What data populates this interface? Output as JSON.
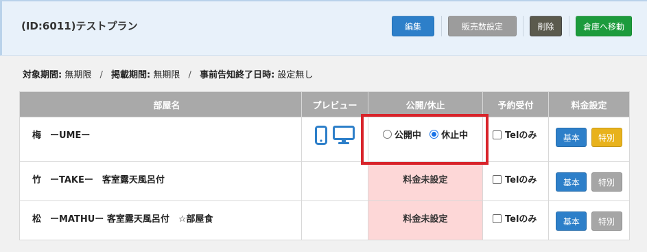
{
  "plan": {
    "title": "(ID:6011)テストプラン"
  },
  "toolbar": {
    "edit_label": "編集",
    "sales_count_label": "販売数設定",
    "delete_label": "削除",
    "move_label": "倉庫へ移動"
  },
  "period": {
    "target_label": "対象期間:",
    "target_value": "無期限",
    "listing_label": "掲載期間:",
    "listing_value": "無期限",
    "notice_label": "事前告知終了日時:",
    "notice_value": "設定無し",
    "separator": "/"
  },
  "table": {
    "headers": {
      "room": "部屋名",
      "preview": "プレビュー",
      "publish": "公開/休止",
      "reservation": "予約受付",
      "fee": "料金設定"
    },
    "rows": [
      {
        "room": "梅　ーUMEー",
        "publish_open_label": "公開中",
        "publish_pause_label": "休止中",
        "publish_selected": "休止中",
        "publish_status": "",
        "tel_label": "Telのみ",
        "tel_checked": false,
        "fee_basic": "基本",
        "fee_special": "特別",
        "fee_special_active": true,
        "preview_icons": [
          "smartphone-icon",
          "monitor-icon"
        ]
      },
      {
        "room": "竹　ーTAKEー　客室露天風呂付",
        "publish_status": "料金未設定",
        "tel_label": "Telのみ",
        "tel_checked": false,
        "fee_basic": "基本",
        "fee_special": "特別",
        "fee_special_active": false
      },
      {
        "room": "松　ーMATHUー 客室露天風呂付　☆部屋食",
        "publish_status": "料金未設定",
        "tel_label": "Telのみ",
        "tel_checked": false,
        "fee_basic": "基本",
        "fee_special": "特別",
        "fee_special_active": false
      }
    ]
  },
  "colors": {
    "header_bg": "#e8f1fa",
    "edit_button": "#2d7fc9",
    "sales_button": "#9c9c9c",
    "delete_button": "#5b5a4d",
    "move_button": "#1c9b3c",
    "unset_cell_bg": "#fdd7d7",
    "highlight_border": "#d8232a",
    "special_active": "#e8b21c",
    "icon_blue": "#2d7fc9"
  }
}
